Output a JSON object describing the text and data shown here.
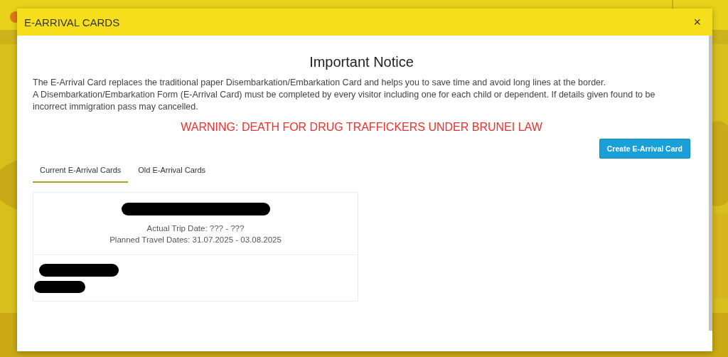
{
  "dialog": {
    "title": "E-ARRIVAL CARDS",
    "close": "×"
  },
  "notice": {
    "heading": "Important Notice",
    "paragraphs": [
      "The E-Arrival Card replaces the traditional paper Disembarkation/Embarkation Card and helps you to save time and avoid long lines at the border.",
      "A Disembarkation/Embarkation Form (E-Arrival Card) must be completed by every visitor including one for each child or dependent. If details given found to be incorrect immigration pass may cancelled."
    ],
    "warning": "WARNING: DEATH FOR DRUG TRAFFICKERS UNDER BRUNEI LAW"
  },
  "create_button": "Create E-Arrival Card",
  "tabs": [
    {
      "label": "Current E-Arrival Cards",
      "selected": true
    },
    {
      "label": "Old E-Arrival Cards",
      "selected": false
    }
  ],
  "cards": [
    {
      "title_redacted": true,
      "lines": [
        "Actual Trip Date: ??? - ???",
        "Planned Travel Dates: 31.07.2025 - 03.08.2025"
      ],
      "footer_redacted": true
    }
  ]
}
